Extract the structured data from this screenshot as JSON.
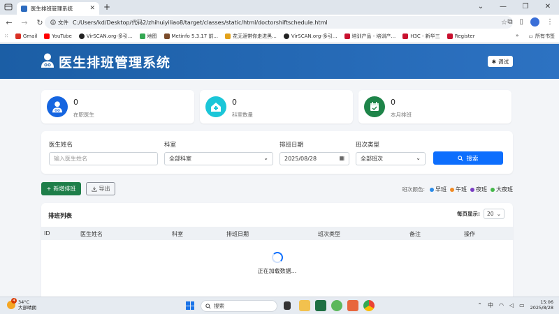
{
  "browser": {
    "tab_title": "医生排班管理系统",
    "file_chip": "文件",
    "url": "C:/Users/kd/Desktop/代码2/zhihuiyiliao8/target/classes/static/html/doctorshiftschedule.html",
    "bookmarks": [
      {
        "label": "Gmail",
        "color": "#d93025"
      },
      {
        "label": "YouTube",
        "color": "#ff0000"
      },
      {
        "label": "VirSCAN.org-多引...",
        "color": "#222222"
      },
      {
        "label": "地图",
        "color": "#34a853"
      },
      {
        "label": "Metinfo 5.3.17 前...",
        "color": "#7b4b2a"
      },
      {
        "label": "花无涯带你走进黑...",
        "color": "#e3a21a"
      },
      {
        "label": "VirSCAN.org-多引...",
        "color": "#222222"
      },
      {
        "label": "培训产品 - 培训产...",
        "color": "#c8102e"
      },
      {
        "label": "H3C - 新华三",
        "color": "#c8102e"
      },
      {
        "label": "Register",
        "color": "#c8102e"
      }
    ],
    "bookmarks_more": "»",
    "all_bookmarks": "所有书签"
  },
  "header": {
    "title": "医生排班管理系统",
    "debug_label": "调试"
  },
  "stats": [
    {
      "value": "0",
      "label": "在职医生",
      "color": "#1565e0"
    },
    {
      "value": "0",
      "label": "科室数量",
      "color": "#1bc6d8"
    },
    {
      "value": "0",
      "label": "本月排班",
      "color": "#1e8449"
    }
  ],
  "filters": {
    "doctor_name_label": "医生姓名",
    "doctor_name_placeholder": "输入医生姓名",
    "dept_label": "科室",
    "dept_value": "全部科室",
    "date_label": "排班日期",
    "date_value": "2025/08/28",
    "shift_type_label": "班次类型",
    "shift_type_value": "全部班次",
    "search_label": "搜索"
  },
  "actions": {
    "add_label": "新增排班",
    "export_label": "导出"
  },
  "legend": {
    "caption": "班次颜色:",
    "items": [
      {
        "label": "早班",
        "color": "#2a8be8"
      },
      {
        "label": "午班",
        "color": "#f08a24"
      },
      {
        "label": "夜班",
        "color": "#7b3fc4"
      },
      {
        "label": "大夜班",
        "color": "#45b84a"
      }
    ]
  },
  "table": {
    "title": "排班列表",
    "per_page_label": "每页显示:",
    "per_page_value": "20",
    "columns": [
      "ID",
      "医生姓名",
      "科室",
      "排班日期",
      "班次类型",
      "备注",
      "操作"
    ],
    "loading_text": "正在加载数据..."
  },
  "taskbar": {
    "temperature": "34°C",
    "weather": "大部晴朗",
    "weather_badge": "4",
    "search_label": "搜索",
    "ime": "中",
    "time": "15:06",
    "date": "2025/8/28"
  }
}
